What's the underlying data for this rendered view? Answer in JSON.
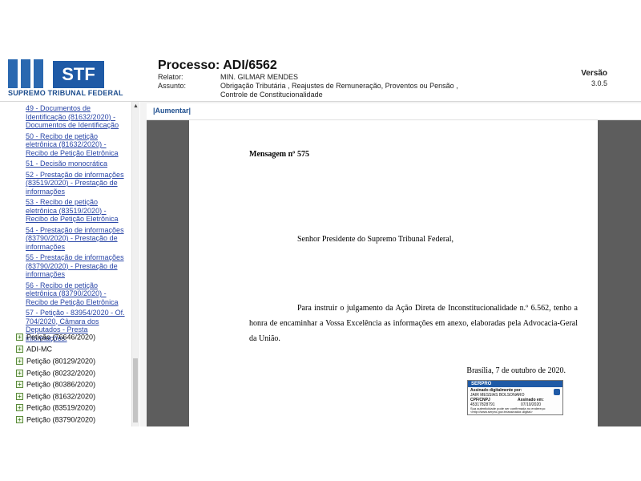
{
  "header": {
    "logo_text": "SUPREMO TRIBUNAL FEDERAL",
    "logo_abbr": "STF",
    "process_title": "Processo: ADI/6562",
    "relator_label": "Relator:",
    "relator_value": "MIN. GILMAR MENDES",
    "assunto_label": "Assunto:",
    "assunto_value_1": "Obrigação Tributária ,    Reajustes de Remuneração, Proventos ou Pensão ,",
    "assunto_value_2": "Controle de Constitucionalidade",
    "version_label": "Versão",
    "version_value": "3.0.5"
  },
  "tree": {
    "links": [
      "49 - Documentos de Identificação (81632/2020) - Documentos de Identificação",
      "50 - Recibo de petição eletrônica (81632/2020) - Recibo de Petição Eletrônica",
      "51 - Decisão monocrática",
      "52 - Prestação de informações (83519/2020) - Prestação de informações",
      "53 - Recibo de petição eletrônica (83519/2020) - Recibo de Petição Eletrônica",
      "54 - Prestação de informações (83790/2020) - Prestação de informações",
      "55 - Prestação de informações (83790/2020) - Prestação de informações",
      "56 - Recibo de petição eletrônica (83790/2020) - Recibo de Petição Eletrônica",
      "57 - Petição - 83954/2020 - Of. 704/2020, Câmara dos Deputados - Presta informações."
    ],
    "folders": [
      "Petição (76646/2020)",
      "ADI-MC",
      "Petição (80129/2020)",
      "Petição (80232/2020)",
      "Petição (80386/2020)",
      "Petição (81632/2020)",
      "Petição (83519/2020)",
      "Petição (83790/2020)"
    ]
  },
  "toolbar": {
    "aumentar": "|Aumentar|"
  },
  "document": {
    "heading": "Mensagem nº 575",
    "salutation": "Senhor Presidente do Supremo Tribunal Federal,",
    "body": "Para instruir o julgamento da Ação Direta de Inconstitucionalidade n.º 6.562, tenho a honra de encaminhar a Vossa Excelência as informações em anexo, elaboradas pela Advocacia-Geral da União.",
    "date": "Brasília, 7 de outubro de 2020.",
    "signature": {
      "brand": "SERPRO",
      "signed_label": "Assinado digitalmente por:",
      "signer": "JAIR MESSIAS BOLSONARO",
      "cpf_label": "CPF/CNPJ",
      "cpf": "45317828791",
      "date_label": "Assinado em:",
      "date": "07/10/2020",
      "footer_1": "Sua autenticidade pode ser confirmada no endereço:",
      "footer_2": "<http://www.serpro.gov.br/assinador-digital>"
    }
  }
}
